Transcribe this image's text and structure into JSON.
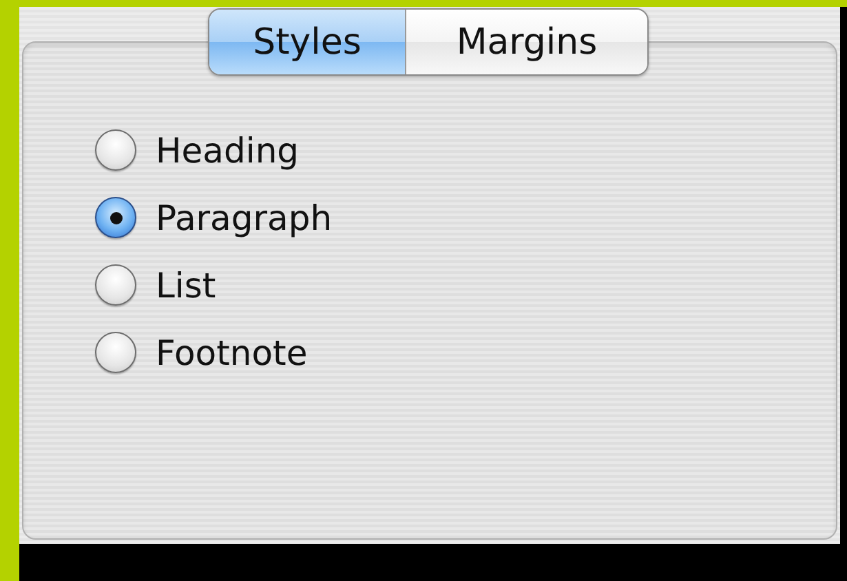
{
  "tabs": [
    {
      "label": "Styles",
      "selected": true
    },
    {
      "label": "Margins",
      "selected": false
    }
  ],
  "options": [
    {
      "label": "Heading",
      "selected": false
    },
    {
      "label": "Paragraph",
      "selected": true
    },
    {
      "label": "List",
      "selected": false
    },
    {
      "label": "Footnote",
      "selected": false
    }
  ]
}
